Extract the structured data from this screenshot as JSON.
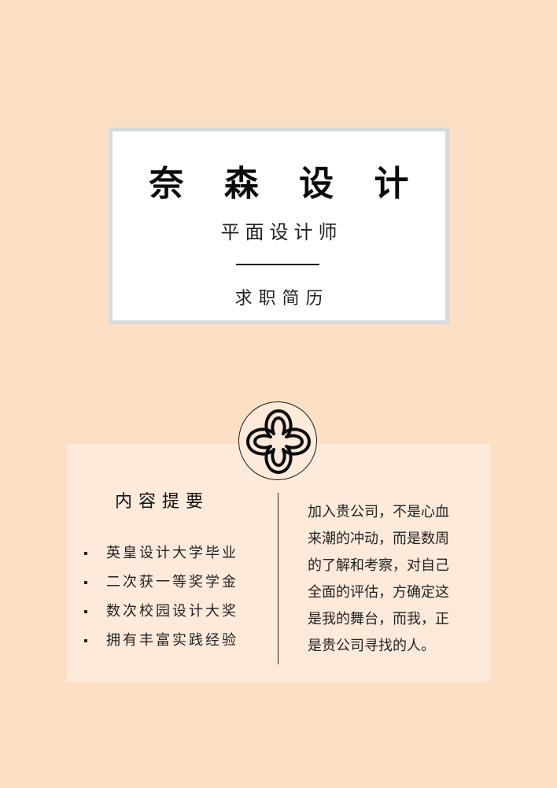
{
  "title_card": {
    "name": "奈 森 设 计",
    "role": "平面设计师",
    "document_type": "求职简历"
  },
  "summary": {
    "heading": "内容提要",
    "highlights": [
      "英皇设计大学毕业",
      "二次获一等奖学金",
      "数次校园设计大奖",
      "拥有丰富实践经验"
    ],
    "statement": "加入贵公司，不是心血\n来潮的冲动，而是数周\n的了解和考察，对自己\n全面的评估，方确定这\n是我的舞台，而我，正\n是贵公司寻找的人。"
  },
  "colors": {
    "page_background": "#FDDFC5",
    "panel_background": "#FEEADB",
    "card_border": "#D7D9DD",
    "text": "#111111"
  },
  "icons": {
    "logo": "four-petal-flower-icon"
  }
}
